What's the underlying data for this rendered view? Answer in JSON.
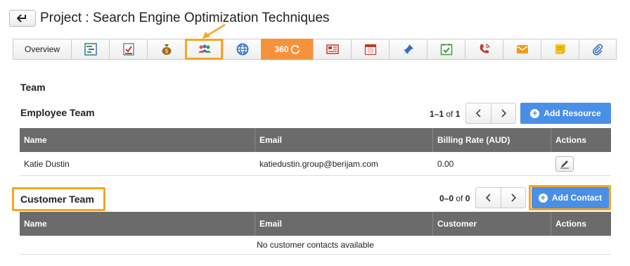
{
  "header": {
    "title": "Project : Search Engine Optimization Techniques",
    "back_icon": "back-arrow-icon"
  },
  "tabs": {
    "overview_label": "Overview",
    "tab_360_label": "360",
    "icons": [
      "gantt-chart-icon",
      "checklist-icon",
      "money-bag-icon",
      "team-icon",
      "globe-icon",
      "360-icon",
      "news-icon",
      "calendar-icon",
      "pin-icon",
      "task-check-icon",
      "phone-call-icon",
      "mail-icon",
      "note-icon",
      "attachment-icon"
    ]
  },
  "team": {
    "heading": "Team",
    "employee": {
      "heading": "Employee Team",
      "range": "1–1",
      "of_label": "of",
      "total": "1",
      "add_label": "Add Resource",
      "columns": [
        "Name",
        "Email",
        "Billing Rate (AUD)",
        "Actions"
      ],
      "rows": [
        {
          "name": "Katie Dustin",
          "email": "katiedustin.group@berijam.com",
          "rate": "0.00"
        }
      ]
    },
    "customer": {
      "heading": "Customer Team",
      "range": "0–0",
      "of_label": "of",
      "total": "0",
      "add_label": "Add Contact",
      "columns": [
        "Name",
        "Email",
        "Customer",
        "Actions"
      ],
      "empty_message": "No customer contacts available"
    }
  },
  "colors": {
    "accent_orange": "#f7923a",
    "highlight_orange": "#f5a623",
    "primary_blue": "#4a8fe7",
    "table_header": "#6b6b6b"
  }
}
